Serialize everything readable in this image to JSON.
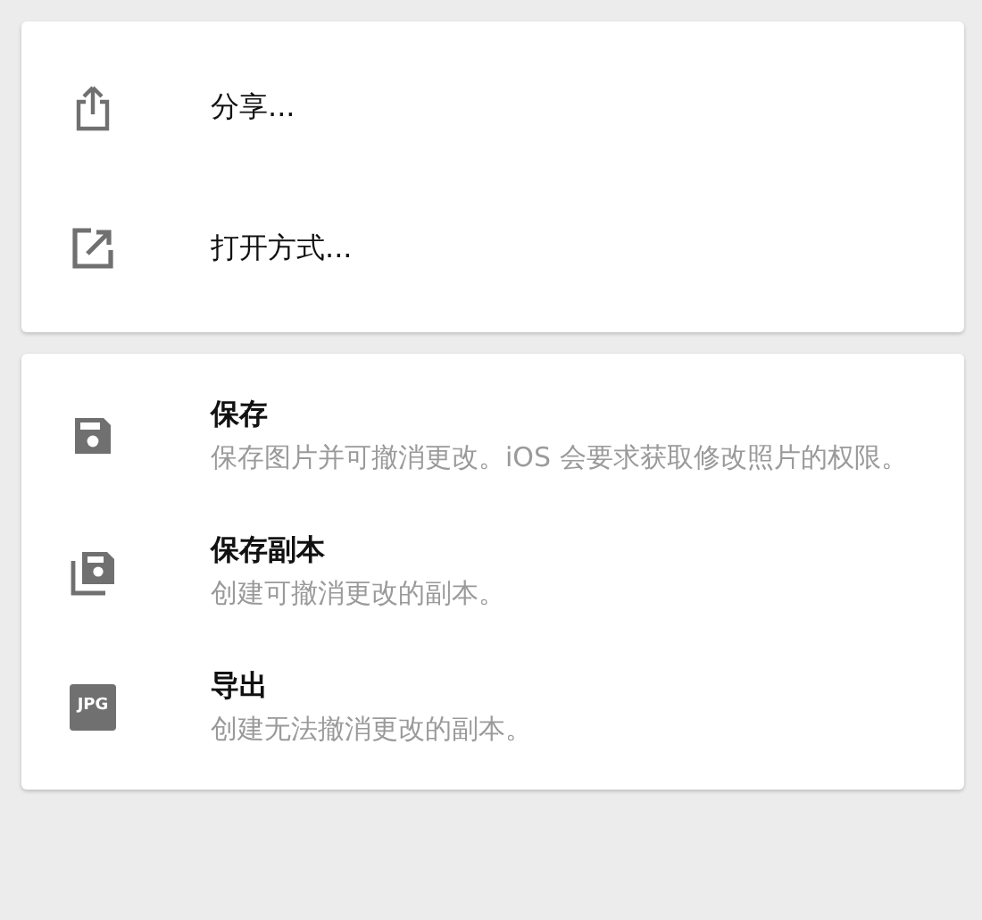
{
  "groups": [
    {
      "items": [
        {
          "kind": "share",
          "title": "分享..."
        },
        {
          "kind": "open",
          "title": "打开方式..."
        }
      ]
    },
    {
      "items": [
        {
          "kind": "save",
          "title": "保存",
          "description": "保存图片并可撤消更改。iOS 会要求获取修改照片的权限。"
        },
        {
          "kind": "copy",
          "title": "保存副本",
          "description": "创建可撤消更改的副本。"
        },
        {
          "kind": "jpg",
          "icon_text": "JPG",
          "title": "导出",
          "description": "创建无法撤消更改的副本。"
        }
      ]
    }
  ]
}
